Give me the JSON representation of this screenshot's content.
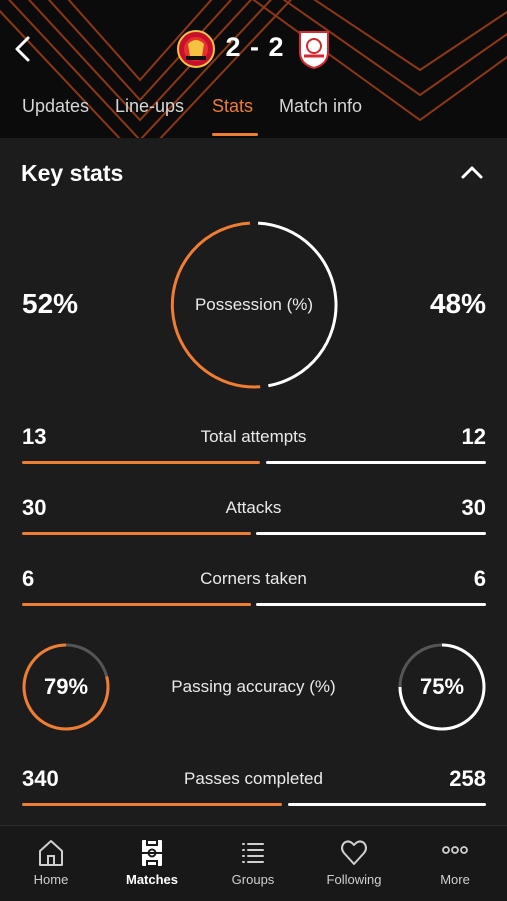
{
  "header": {
    "home_team_crest": "manchester-united-crest",
    "away_team_crest": "sevilla-crest",
    "score": "2 - 2",
    "tabs": [
      {
        "label": "Updates",
        "active": false
      },
      {
        "label": "Line-ups",
        "active": false
      },
      {
        "label": "Stats",
        "active": true
      },
      {
        "label": "Match info",
        "active": false
      }
    ]
  },
  "key_stats": {
    "title": "Key stats",
    "possession": {
      "label": "Possession (%)",
      "home": "52%",
      "away": "48%",
      "home_fraction": 0.52
    },
    "rows": [
      {
        "label": "Total attempts",
        "home": "13",
        "away": "12"
      },
      {
        "label": "Attacks",
        "home": "30",
        "away": "30"
      },
      {
        "label": "Corners taken",
        "home": "6",
        "away": "6"
      }
    ],
    "passing_accuracy": {
      "label": "Passing accuracy (%)",
      "home": "79%",
      "away": "75%",
      "home_fraction": 0.79,
      "away_fraction": 0.75
    },
    "passes_completed": {
      "label": "Passes completed",
      "home": "340",
      "away": "258"
    }
  },
  "bottom_nav": [
    {
      "label": "Home",
      "icon": "home-icon",
      "active": false
    },
    {
      "label": "Matches",
      "icon": "pitch-icon",
      "active": true
    },
    {
      "label": "Groups",
      "icon": "list-icon",
      "active": false
    },
    {
      "label": "Following",
      "icon": "heart-icon",
      "active": false
    },
    {
      "label": "More",
      "icon": "more-icon",
      "active": false
    }
  ],
  "colors": {
    "accent": "#ef7d32",
    "away": "#ffffff",
    "background": "#1c1c1c",
    "header": "#0b0b0b"
  }
}
